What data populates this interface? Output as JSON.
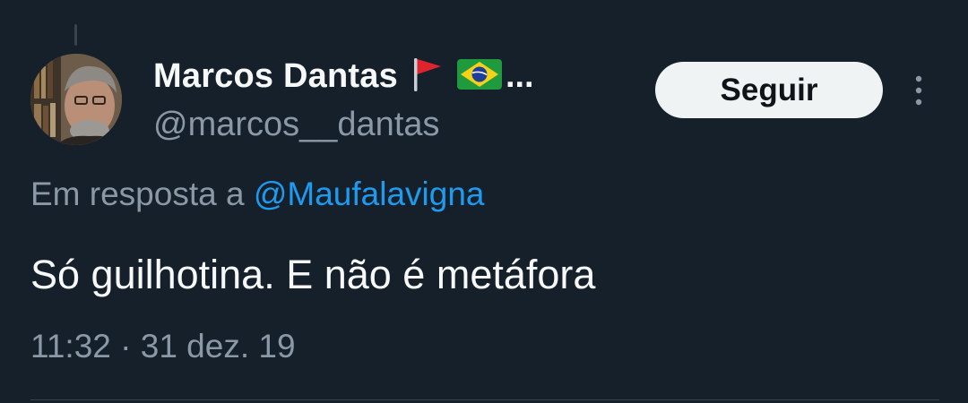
{
  "author": {
    "display_name": "Marcos Dantas",
    "name_suffix": "...",
    "handle": "@marcos__dantas",
    "badges": [
      "red-triangular-flag-icon",
      "brazil-flag-icon"
    ]
  },
  "actions": {
    "follow_label": "Seguir",
    "more_icon": "more-vertical-icon"
  },
  "reply": {
    "prefix": "Em resposta a",
    "mention": "@Maufalavigna"
  },
  "tweet": {
    "text": "Só guilhotina. E não é metáfora",
    "time": "11:32",
    "separator": "·",
    "date": "31 dez. 19"
  },
  "colors": {
    "background": "#15202b",
    "primary_text": "#f7f9f9",
    "secondary_text": "#8b98a5",
    "link": "#1d9bf0",
    "button_bg": "#eff3f4",
    "divider": "#38444d"
  }
}
